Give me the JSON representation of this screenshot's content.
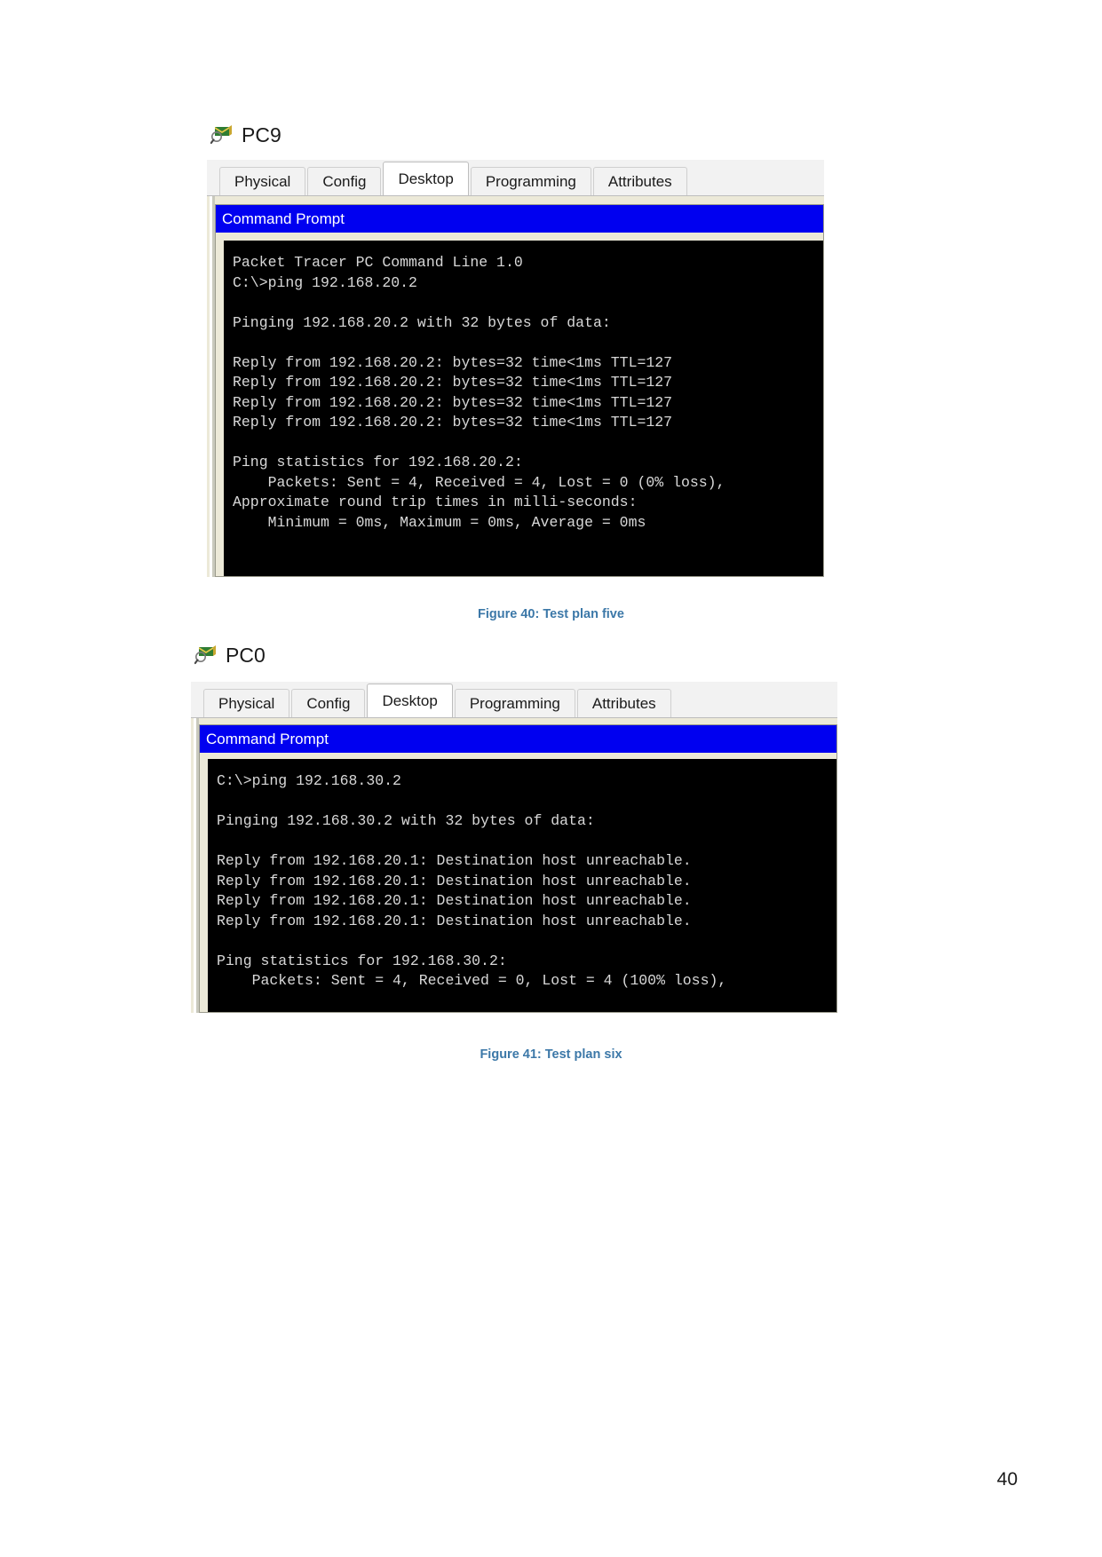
{
  "page": {
    "number": "40"
  },
  "figures": [
    {
      "device": {
        "name": "PC9",
        "icon": "pc-magnifier-icon"
      },
      "tabs": [
        {
          "label": "Physical",
          "active": false
        },
        {
          "label": "Config",
          "active": false
        },
        {
          "label": "Desktop",
          "active": true
        },
        {
          "label": "Programming",
          "active": false
        },
        {
          "label": "Attributes",
          "active": false
        }
      ],
      "command_prompt": {
        "title": "Command Prompt",
        "lines": [
          "Packet Tracer PC Command Line 1.0",
          "C:\\>ping 192.168.20.2",
          "",
          "Pinging 192.168.20.2 with 32 bytes of data:",
          "",
          "Reply from 192.168.20.2: bytes=32 time<1ms TTL=127",
          "Reply from 192.168.20.2: bytes=32 time<1ms TTL=127",
          "Reply from 192.168.20.2: bytes=32 time<1ms TTL=127",
          "Reply from 192.168.20.2: bytes=32 time<1ms TTL=127",
          "",
          "Ping statistics for 192.168.20.2:",
          "    Packets: Sent = 4, Received = 4, Lost = 0 (0% loss),",
          "Approximate round trip times in milli-seconds:",
          "    Minimum = 0ms, Maximum = 0ms, Average = 0ms"
        ]
      },
      "caption": "Figure 40: Test plan five"
    },
    {
      "device": {
        "name": "PC0",
        "icon": "pc-magnifier-icon"
      },
      "tabs": [
        {
          "label": "Physical",
          "active": false
        },
        {
          "label": "Config",
          "active": false
        },
        {
          "label": "Desktop",
          "active": true
        },
        {
          "label": "Programming",
          "active": false
        },
        {
          "label": "Attributes",
          "active": false
        }
      ],
      "command_prompt": {
        "title": "Command Prompt",
        "lines": [
          "C:\\>ping 192.168.30.2",
          "",
          "Pinging 192.168.30.2 with 32 bytes of data:",
          "",
          "Reply from 192.168.20.1: Destination host unreachable.",
          "Reply from 192.168.20.1: Destination host unreachable.",
          "Reply from 192.168.20.1: Destination host unreachable.",
          "Reply from 192.168.20.1: Destination host unreachable.",
          "",
          "Ping statistics for 192.168.30.2:",
          "    Packets: Sent = 4, Received = 0, Lost = 4 (100% loss),"
        ]
      },
      "caption": "Figure 41: Test plan six"
    }
  ],
  "colors": {
    "caption": "#3c78a8",
    "titlebar": "#0000f0",
    "terminal_bg": "#000000",
    "terminal_fg": "#d8d8d8",
    "window_bg": "#ece9d8"
  }
}
